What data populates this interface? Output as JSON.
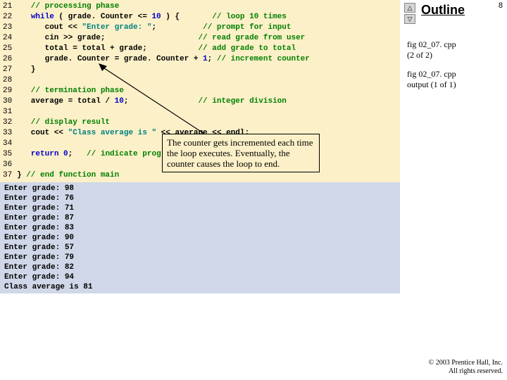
{
  "pageNum": "8",
  "outlineTitle": "Outline",
  "captions": {
    "c1a": "fig 02_07. cpp",
    "c1b": "(2 of 2)",
    "c2a": "fig 02_07. cpp",
    "c2b": "output (1 of 1)"
  },
  "callout": "The counter gets incremented each time the loop executes. Eventually, the counter causes the loop to end.",
  "copyright1": "© 2003 Prentice Hall, Inc.",
  "copyright2": "All rights reserved.",
  "navUp": "△",
  "navDown": "▽",
  "code": {
    "l21": {
      "n": "21",
      "c": "   // processing phase"
    },
    "l22": {
      "n": "22",
      "pre": "   ",
      "kw": "while",
      "mid": " ( grade. Counter <= ",
      "num": "10",
      "post": " ) {       ",
      "cm": "// loop 10 times"
    },
    "l23": {
      "n": "23",
      "pre": "      cout << ",
      "str": "\"Enter grade: \"",
      "post": ";          ",
      "cm": "// prompt for input"
    },
    "l24": {
      "n": "24",
      "pre": "      cin >> grade;                    ",
      "cm": "// read grade from user"
    },
    "l25": {
      "n": "25",
      "pre": "      total = total + grade;           ",
      "cm": "// add grade to total"
    },
    "l26": {
      "n": "26",
      "pre": "      grade. Counter = grade. Counter + ",
      "num": "1",
      "post": "; ",
      "cm": "// increment counter"
    },
    "l27": {
      "n": "27",
      "pre": "   }"
    },
    "l28": {
      "n": "28",
      "pre": ""
    },
    "l29": {
      "n": "29",
      "c": "   // termination phase"
    },
    "l30": {
      "n": "30",
      "pre": "   average = total / ",
      "num": "10",
      "post": ";               ",
      "cm": "// integer division"
    },
    "l31": {
      "n": "31",
      "pre": ""
    },
    "l32": {
      "n": "32",
      "c": "   // display result"
    },
    "l33": {
      "n": "33",
      "pre": "   cout << ",
      "str": "\"Class average is \"",
      "post": " << average << endl;"
    },
    "l34": {
      "n": "34",
      "pre": ""
    },
    "l35": {
      "n": "35",
      "pre": "   ",
      "kw": "return",
      "mid": " ",
      "num": "0",
      "post": ";   ",
      "cm": "// indicate program ended successfully"
    },
    "l36": {
      "n": "36",
      "pre": ""
    },
    "l37": {
      "n": "37",
      "pre": "} ",
      "cm": "// end function main"
    }
  },
  "output": "Enter grade: 98\nEnter grade: 76\nEnter grade: 71\nEnter grade: 87\nEnter grade: 83\nEnter grade: 90\nEnter grade: 57\nEnter grade: 79\nEnter grade: 82\nEnter grade: 94\nClass average is 81"
}
